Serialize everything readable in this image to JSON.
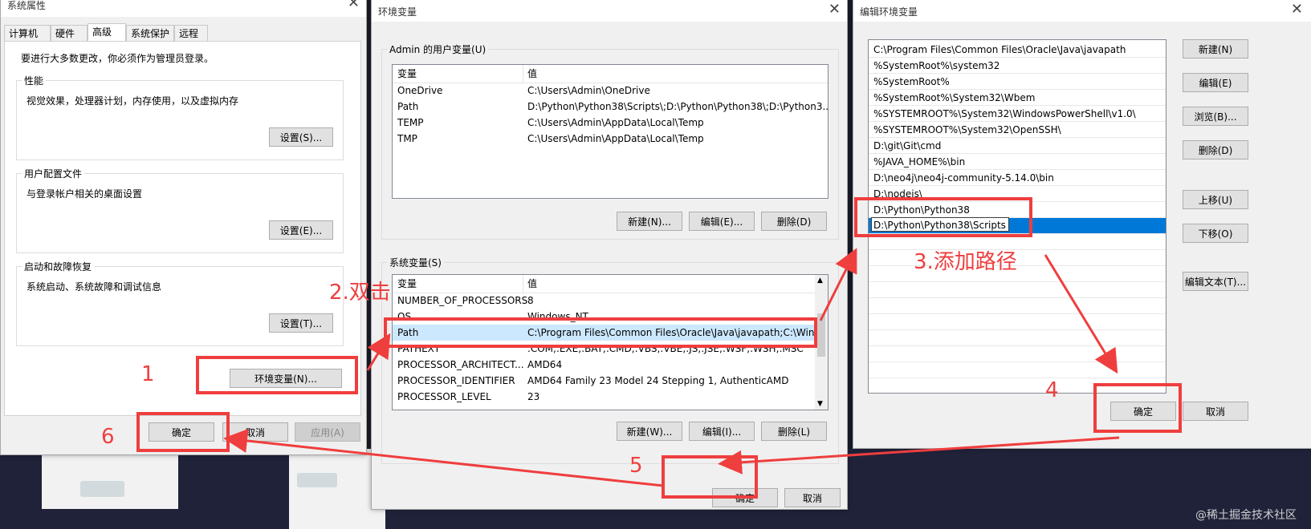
{
  "sys_props": {
    "title": "系统属性",
    "tabs": [
      "计算机名",
      "硬件",
      "高级",
      "系统保护",
      "远程"
    ],
    "admin_note": "要进行大多数更改，你必须作为管理员登录。",
    "perf": {
      "title": "性能",
      "desc": "视觉效果，处理器计划，内存使用，以及虚拟内存",
      "btn": "设置(S)..."
    },
    "profile": {
      "title": "用户配置文件",
      "desc": "与登录帐户相关的桌面设置",
      "btn": "设置(E)..."
    },
    "startup": {
      "title": "启动和故障恢复",
      "desc": "系统启动、系统故障和调试信息",
      "btn": "设置(T)..."
    },
    "env_btn": "环境变量(N)...",
    "ok": "确定",
    "cancel": "取消",
    "apply": "应用(A)"
  },
  "env_vars": {
    "title": "环境变量",
    "user_group": "Admin 的用户变量(U)",
    "col_var": "变量",
    "col_val": "值",
    "user_rows": [
      {
        "name": "OneDrive",
        "value": "C:\\Users\\Admin\\OneDrive"
      },
      {
        "name": "Path",
        "value": "D:\\Python\\Python38\\Scripts\\;D:\\Python\\Python38\\;D:\\Python3..."
      },
      {
        "name": "TEMP",
        "value": "C:\\Users\\Admin\\AppData\\Local\\Temp"
      },
      {
        "name": "TMP",
        "value": "C:\\Users\\Admin\\AppData\\Local\\Temp"
      }
    ],
    "user_btns": [
      "新建(N)...",
      "编辑(E)...",
      "删除(D)"
    ],
    "sys_group": "系统变量(S)",
    "sys_rows": [
      {
        "name": "NUMBER_OF_PROCESSORS",
        "value": "8"
      },
      {
        "name": "OS",
        "value": "Windows_NT"
      },
      {
        "name": "Path",
        "value": "C:\\Program Files\\Common Files\\Oracle\\Java\\javapath;C:\\Win..."
      },
      {
        "name": "PATHEXT",
        "value": ".COM;.EXE;.BAT;.CMD;.VBS;.VBE;.JS;.JSE;.WSF;.WSH;.MSC"
      },
      {
        "name": "PROCESSOR_ARCHITECT...",
        "value": "AMD64"
      },
      {
        "name": "PROCESSOR_IDENTIFIER",
        "value": "AMD64 Family 23 Model 24 Stepping 1, AuthenticAMD"
      },
      {
        "name": "PROCESSOR_LEVEL",
        "value": "23"
      }
    ],
    "sys_btns": [
      "新建(W)...",
      "编辑(I)...",
      "删除(L)"
    ],
    "ok": "确定",
    "cancel": "取消"
  },
  "edit_env": {
    "title": "编辑环境变量",
    "paths": [
      "C:\\Program Files\\Common Files\\Oracle\\Java\\javapath",
      "%SystemRoot%\\system32",
      "%SystemRoot%",
      "%SystemRoot%\\System32\\Wbem",
      "%SYSTEMROOT%\\System32\\WindowsPowerShell\\v1.0\\",
      "%SYSTEMROOT%\\System32\\OpenSSH\\",
      "D:\\git\\Git\\cmd",
      "%JAVA_HOME%\\bin",
      "D:\\neo4j\\neo4j-community-5.14.0\\bin",
      "D:\\nodejs\\",
      "D:\\Python\\Python38"
    ],
    "editing_value": "D:\\Python\\Python38\\Scripts",
    "btns": {
      "new": "新建(N)",
      "edit": "编辑(E)",
      "browse": "浏览(B)...",
      "delete": "删除(D)",
      "up": "上移(U)",
      "down": "下移(O)",
      "edit_text": "编辑文本(T)..."
    },
    "ok": "确定",
    "cancel": "取消"
  },
  "annotations": {
    "step1": "1",
    "step2": "2.双击",
    "step3": "3.添加路径",
    "step4": "4",
    "step5": "5",
    "step6": "6"
  },
  "colors": {
    "annotation_red": "#ef3e3e",
    "selection_blue": "#0078d7"
  },
  "watermark": "@稀土掘金技术社区"
}
